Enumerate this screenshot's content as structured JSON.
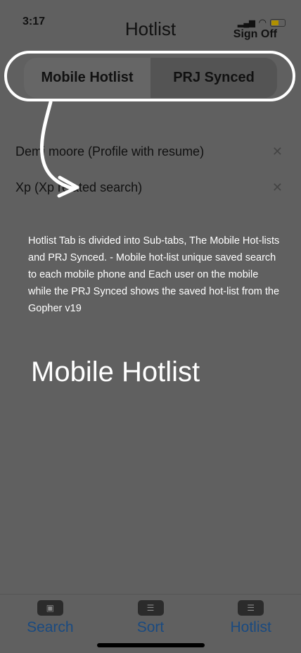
{
  "status_bar": {
    "time": "3:17"
  },
  "header": {
    "title": "Hotlist",
    "sign_off": "Sign Off"
  },
  "segments": [
    {
      "label": "Mobile Hotlist",
      "active": true
    },
    {
      "label": "PRJ Synced",
      "active": false
    }
  ],
  "hotlist_items": [
    {
      "label": "Demi moore (Profile with resume)"
    },
    {
      "label": "Xp (Xp related search)"
    }
  ],
  "annotation": {
    "note": "Hotlist Tab is divided into Sub-tabs, The Mobile Hot-lists and PRJ Synced. - Mobile hot-list unique saved search  to each mobile phone and Each user on the mobile while the PRJ Synced shows the saved hot-list from the Gopher v19",
    "heading": "Mobile Hotlist"
  },
  "tab_bar": [
    {
      "label": "Search",
      "icon": "id-card-icon"
    },
    {
      "label": "Sort",
      "icon": "filter-icon"
    },
    {
      "label": "Hotlist",
      "icon": "list-icon"
    }
  ]
}
